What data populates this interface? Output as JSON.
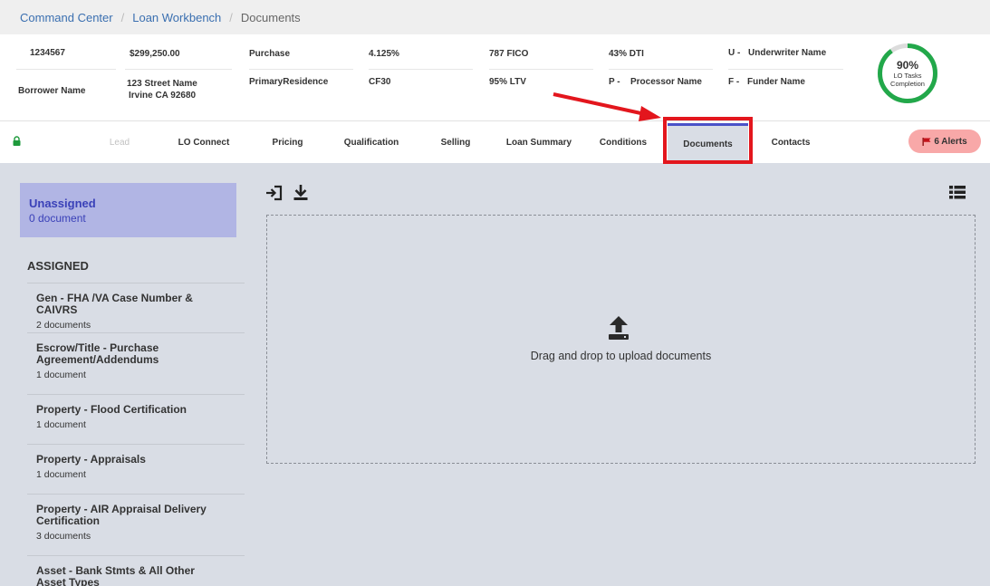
{
  "breadcrumb": {
    "items": [
      "Command Center",
      "Loan Workbench"
    ],
    "current": "Documents"
  },
  "loan": {
    "loan_number": "1234567",
    "borrower_label": "Borrower Name",
    "amount": "$299,250.00",
    "address_line1": "123 Street Name",
    "address_line2": "Irvine CA 92680",
    "purpose": "Purchase",
    "occupancy": "PrimaryResidence",
    "rate": "4.125%",
    "program": "CF30",
    "fico": "787 FICO",
    "ltv": "95% LTV",
    "dti": "43% DTI",
    "processor_prefix": "P -",
    "processor": "Processor Name",
    "underwriter_prefix": "U -",
    "underwriter": "Underwriter Name",
    "funder_prefix": "F -",
    "funder": "Funder Name"
  },
  "completion": {
    "percent_label": "90%",
    "percent_value": 0.9,
    "label": "LO Tasks Completion",
    "color": "#22a84a"
  },
  "tabs": [
    {
      "label": "Lead",
      "state": "disabled"
    },
    {
      "label": "LO Connect",
      "state": "normal"
    },
    {
      "label": "Pricing",
      "state": "normal"
    },
    {
      "label": "Qualification",
      "state": "normal"
    },
    {
      "label": "Selling",
      "state": "normal"
    },
    {
      "label": "Loan Summary",
      "state": "normal"
    },
    {
      "label": "Conditions",
      "state": "normal"
    },
    {
      "label": "Documents",
      "state": "active"
    },
    {
      "label": "Contacts",
      "state": "normal"
    }
  ],
  "alerts": {
    "label": "6 Alerts",
    "icon": "flag-icon"
  },
  "sidebar": {
    "unassigned_title": "Unassigned",
    "unassigned_count": "0 document",
    "assigned_heading": "ASSIGNED",
    "items": [
      {
        "name": "Gen - FHA /VA Case Number & CAIVRS",
        "count": "2 documents"
      },
      {
        "name": "Escrow/Title - Purchase Agreement/Addendums",
        "count": "1 document"
      },
      {
        "name": "Property - Flood Certification",
        "count": "1 document"
      },
      {
        "name": "Property - Appraisals",
        "count": "1 document"
      },
      {
        "name": "Property - AIR Appraisal Delivery Certification",
        "count": "3 documents"
      },
      {
        "name": "Asset - Bank Stmts & All Other Asset Types",
        "count": ""
      }
    ]
  },
  "toolbar": {
    "icons": [
      "import-icon",
      "download-icon",
      "list-view-icon"
    ]
  },
  "dropzone": {
    "text": "Drag and drop to upload documents",
    "icon": "upload-icon"
  },
  "colors": {
    "accent": "#4a52c8",
    "callout": "#e3161d",
    "alert_bg": "#f8a8a8",
    "link": "#3a6fb0"
  }
}
